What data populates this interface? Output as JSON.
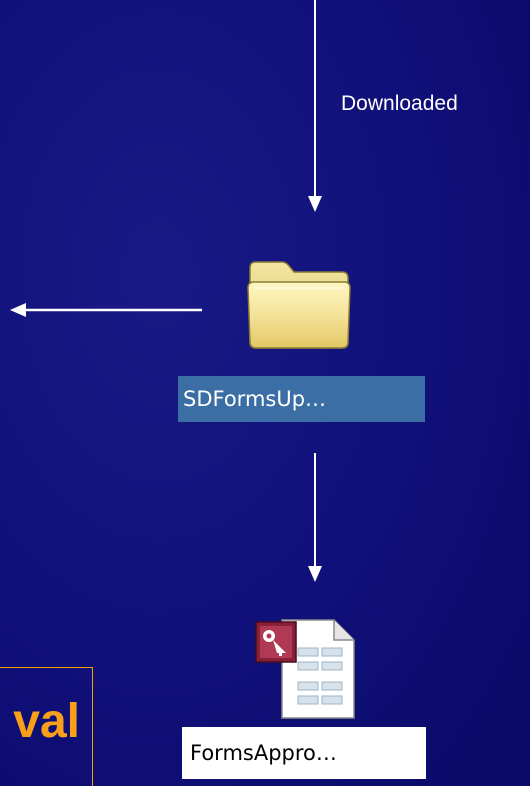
{
  "slide": {
    "background_color": "#0c0c6e",
    "accent_color": "#f9a01b",
    "arrow_color": "#ffffff"
  },
  "labels": {
    "downloaded": "Downloaded"
  },
  "folder": {
    "icon": "folder-icon",
    "name": "SDFormsUp…",
    "selected": true,
    "selection_color": "#3a6ea5"
  },
  "access_file": {
    "icon": "access-database-icon",
    "name": "FormsAppro…"
  },
  "callout": {
    "text": "val"
  }
}
